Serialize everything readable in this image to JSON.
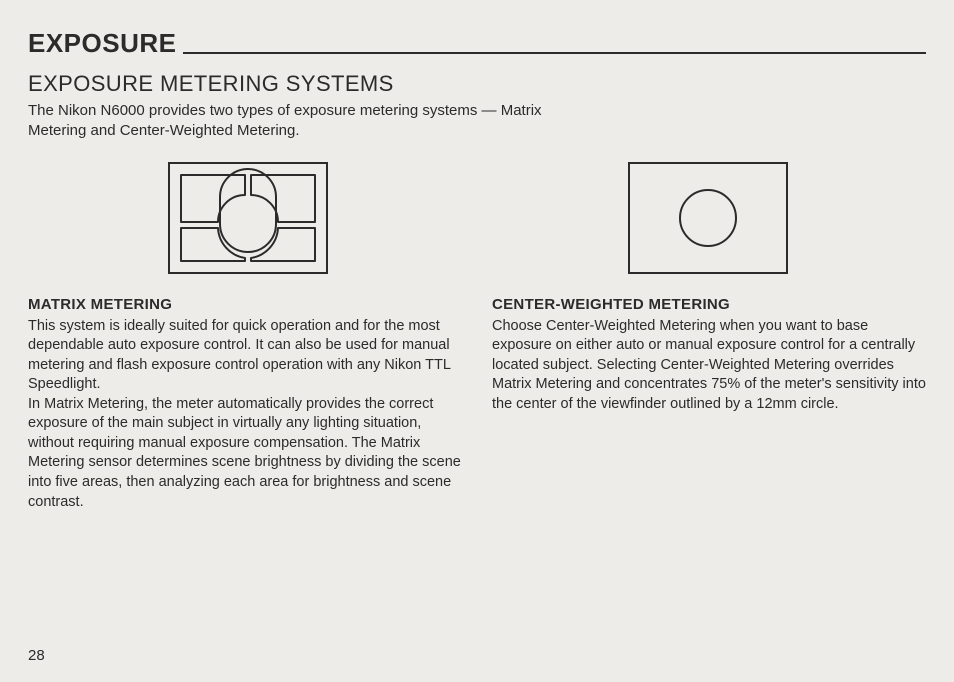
{
  "chapter": "EXPOSURE",
  "section": "EXPOSURE METERING SYSTEMS",
  "intro": "The Nikon N6000 provides two types of exposure metering systems — Matrix Metering and Center-Weighted Metering.",
  "matrix": {
    "heading": "MATRIX METERING",
    "p1": "This system is ideally suited for quick operation and for the most dependable auto exposure control. It can also be used for manual metering and flash exposure control operation with any Nikon TTL Speedlight.",
    "p2": "In Matrix Metering, the meter automatically provides the correct exposure of the main subject in virtually any lighting situation, without requiring manual exposure compensation. The Matrix Metering sensor determines scene brightness by dividing the scene into five areas, then analyzing each area for brightness and scene contrast."
  },
  "center": {
    "heading": "CENTER-WEIGHTED METERING",
    "p1": "Choose Center-Weighted Metering when you want to base exposure on either auto or manual exposure control for a centrally located subject. Selecting Center-Weighted Metering overrides Matrix Metering and concentrates 75% of the meter's sensitivity into the center of the viewfinder outlined by a 12mm circle."
  },
  "pageNumber": "28"
}
